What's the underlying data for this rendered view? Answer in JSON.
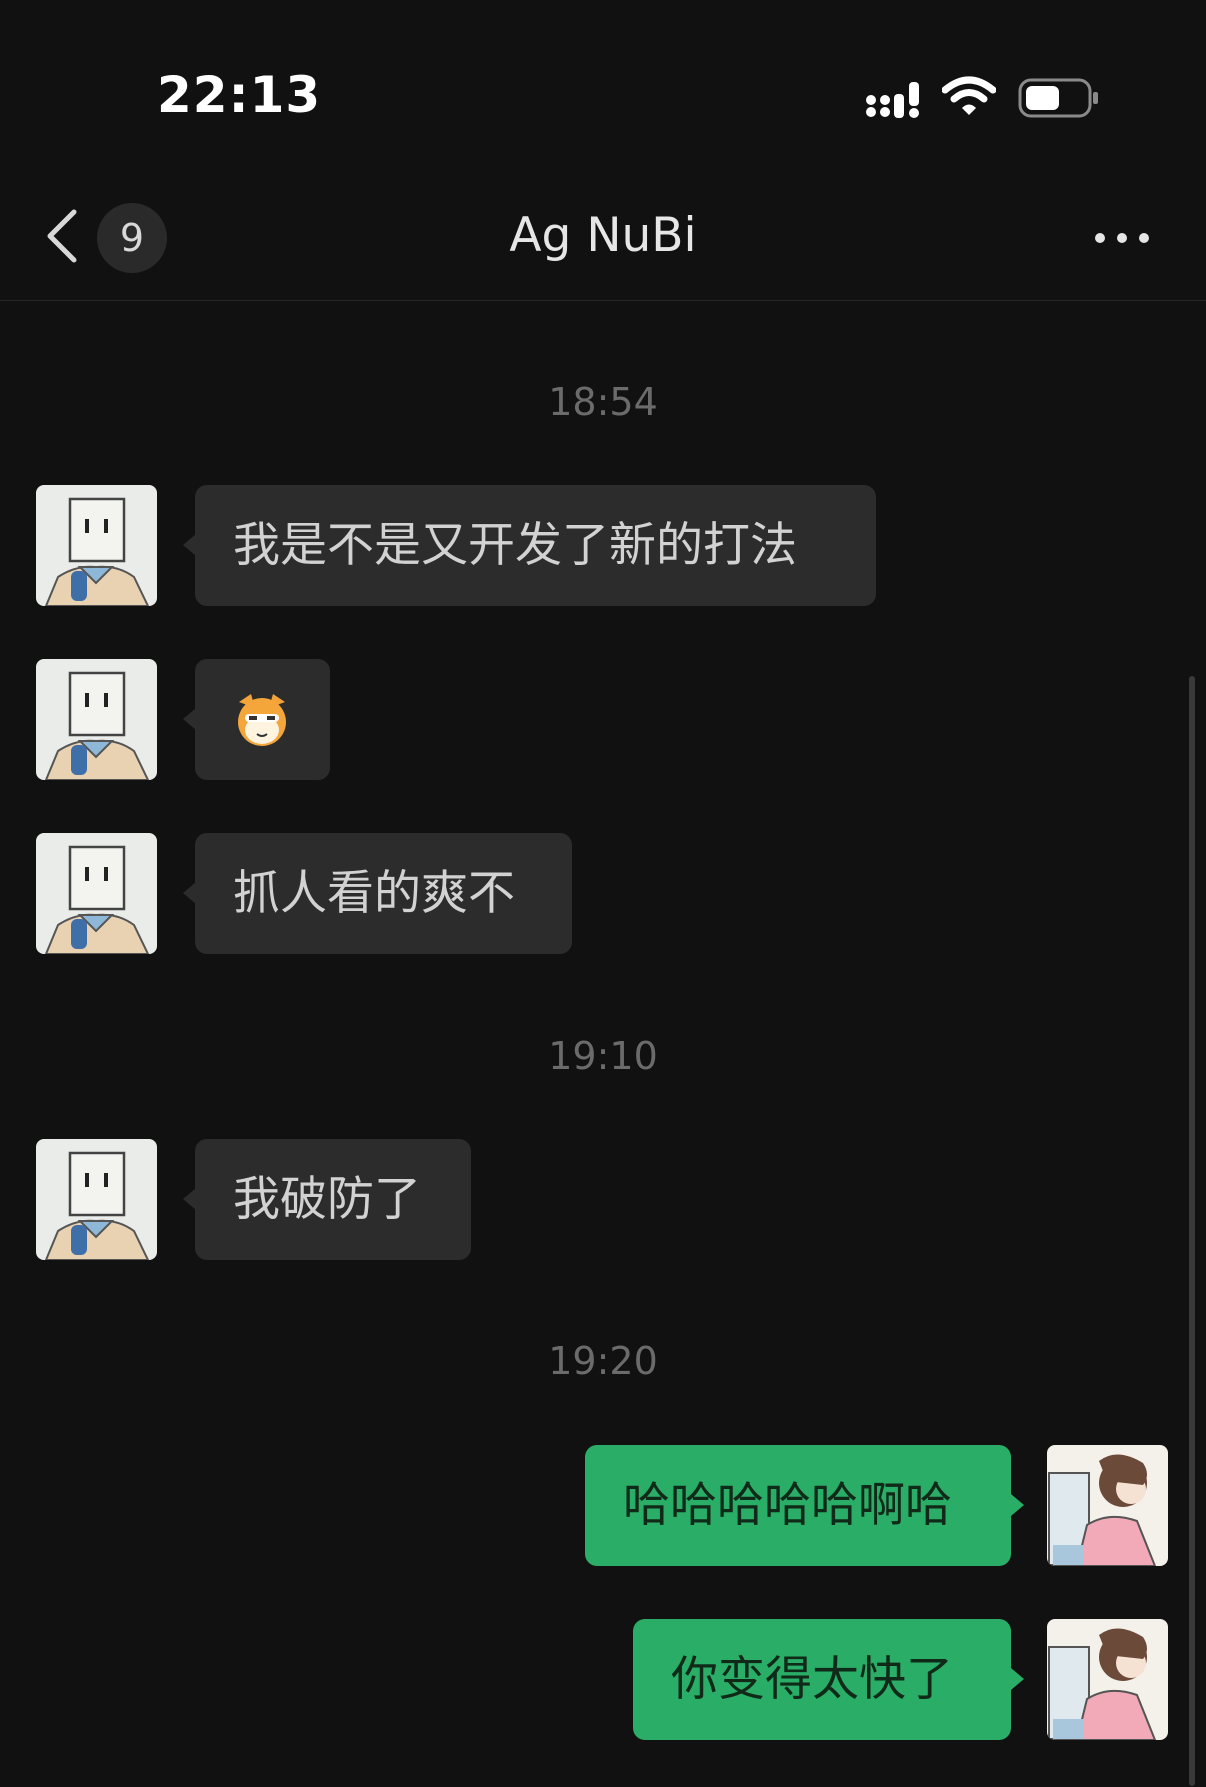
{
  "status_bar": {
    "time": "22:13",
    "battery_level": 0.45,
    "icons": [
      "signal-icon",
      "wifi-icon",
      "battery-icon"
    ]
  },
  "nav": {
    "back_icon": "chevron-left-icon",
    "unread_count": "9",
    "title": "Ag NuBi",
    "more_icon": "ellipsis-icon"
  },
  "messages": {
    "ts1": "18:54",
    "m1": "我是不是又开发了新的打法",
    "m2_sticker": "cat-sticker",
    "m3": "抓人看的爽不",
    "ts2": "19:10",
    "m4": "我破防了",
    "ts3": "19:20",
    "m5": "哈哈哈哈哈啊哈",
    "m6": "你变得太快了"
  },
  "colors": {
    "background": "#111111",
    "incoming_bubble": "#2c2c2c",
    "outgoing_bubble": "#2aae67",
    "timestamp": "#6b6b6b"
  }
}
